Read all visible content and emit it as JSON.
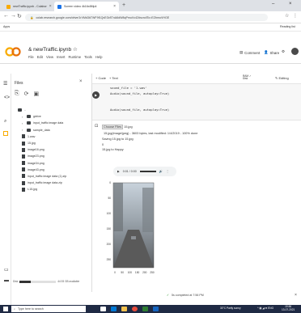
{
  "browser": {
    "tabs": [
      {
        "title": "newTraffic.ipynb - Colabor",
        "favicon_color": "#f9ab00",
        "active": false
      },
      {
        "title": "Screen video 4k16x8Mp4",
        "favicon_color": "#1a73e8",
        "active": true
      }
    ],
    "new_tab": "+",
    "url": "colab.research.google.com/drive/1rVMd3kTWF9f1QvEGr8TnA6dW8qPmuVc42#scrollTo=EZbmuVHGE",
    "bookmark_left": "Apps",
    "bookmark_right": "Reading list"
  },
  "colab": {
    "logo_color": "#f9ab00",
    "notebook_title": "newTraffic.ipynb",
    "menu": [
      "File",
      "Edit",
      "View",
      "Insert",
      "Runtime",
      "Tools",
      "Help"
    ],
    "comment_label": "Comment",
    "share_label": "Share",
    "add_code": "+ Code",
    "add_text": "+ Text",
    "ram_label": "RAM",
    "disk_label": "Disk",
    "editing_label": "Editing"
  },
  "files_panel": {
    "title": "Files",
    "tree": [
      {
        "name": "..",
        "kind": "parent",
        "indent": 0
      },
      {
        "name": "gdrive",
        "kind": "folder",
        "indent": 1
      },
      {
        "name": "input_traffic image data",
        "kind": "folder",
        "indent": 1
      },
      {
        "name": "sample_data",
        "kind": "folder",
        "indent": 1
      },
      {
        "name": "1.wav",
        "kind": "file",
        "indent": 1
      },
      {
        "name": "15.jpg",
        "kind": "file",
        "indent": 1
      },
      {
        "name": "image16.png",
        "kind": "file",
        "indent": 1
      },
      {
        "name": "image23.png",
        "kind": "file",
        "indent": 1
      },
      {
        "name": "image34.png",
        "kind": "file",
        "indent": 1
      },
      {
        "name": "image43.png",
        "kind": "file",
        "indent": 1
      },
      {
        "name": "input_traffic image data (1).zip",
        "kind": "file",
        "indent": 1
      },
      {
        "name": "input_traffic image data.zip",
        "kind": "file",
        "indent": 1
      },
      {
        "name": "t-15.jpg",
        "kind": "file",
        "indent": 1
      }
    ],
    "disk_text": "44.93 GB available",
    "disk_fraction": 0.3
  },
  "cell": {
    "lines": [
      "sound_file = '1.wav'",
      "Audio(sound_file, autoplay=True)",
      "",
      "Audio(sound_file, autoplay=True)"
    ],
    "output": {
      "header": "Choose Files  15.jpg",
      "upload_line": "15.jpg(image/jpeg) - 3603 bytes, last modified: 1/4/2019 - 100% done",
      "saving_line": "Saving 15.jpg to 15.jpg",
      "zero": "0",
      "text_to_speech": "15.jpg to Happy",
      "audio_time": "0:01 / 0:00"
    }
  },
  "plot": {
    "yticks": [
      "0",
      "50",
      "100",
      "150",
      "200",
      "250"
    ],
    "xticks": [
      "0",
      "50",
      "100",
      "150",
      "200",
      "250"
    ]
  },
  "statusbar": {
    "text": "5s   completed at 7:56 PM"
  },
  "taskbar": {
    "search_placeholder": "Type here to search",
    "weather": "30°C  Partly sunny",
    "time": "19:56",
    "date": "13-07-2021"
  }
}
